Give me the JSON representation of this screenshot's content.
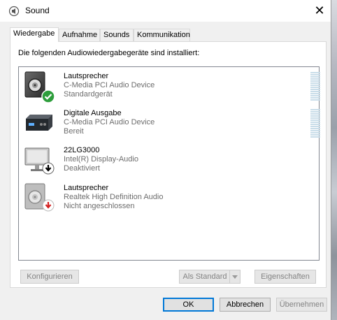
{
  "window": {
    "title": "Sound",
    "close_glyph": "✕"
  },
  "tabs": [
    {
      "label": "Wiedergabe",
      "active": true
    },
    {
      "label": "Aufnahme",
      "active": false
    },
    {
      "label": "Sounds",
      "active": false
    },
    {
      "label": "Kommunikation",
      "active": false
    }
  ],
  "panel": {
    "header": "Die folgenden Audiowiedergabegeräte sind installiert:"
  },
  "devices": [
    {
      "name": "Lautsprecher",
      "driver": "C-Media PCI Audio Device",
      "status": "Standardgerät",
      "icon": "speaker-icon",
      "badge": "default-check-icon"
    },
    {
      "name": "Digitale Ausgabe",
      "driver": "C-Media PCI Audio Device",
      "status": "Bereit",
      "icon": "digital-output-icon",
      "badge": ""
    },
    {
      "name": "22LG3000",
      "driver": "Intel(R) Display-Audio",
      "status": "Deaktiviert",
      "icon": "monitor-icon",
      "badge": "disabled-arrow-icon"
    },
    {
      "name": "Lautsprecher",
      "driver": "Realtek High Definition Audio",
      "status": "Nicht angeschlossen",
      "icon": "speaker-icon",
      "badge": "unplugged-arrow-icon"
    }
  ],
  "buttons": {
    "configure": "Konfigurieren",
    "set_default": "Als Standard",
    "properties": "Eigenschaften",
    "ok": "OK",
    "cancel": "Abbrechen",
    "apply": "Übernehmen"
  },
  "colors": {
    "accent": "#0078d7",
    "check_green": "#2e9e3c",
    "warning_red": "#d32222",
    "meter": "#c9dde9"
  }
}
